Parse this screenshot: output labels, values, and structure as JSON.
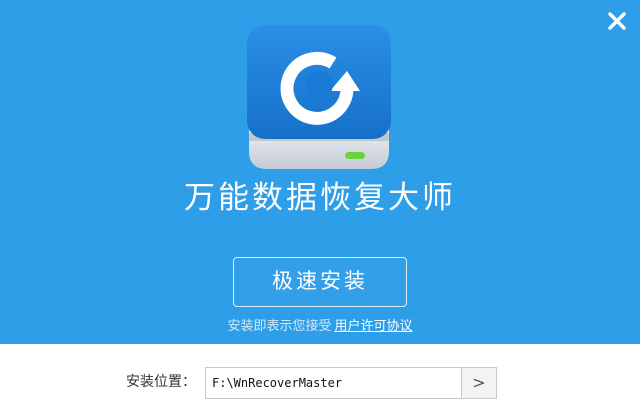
{
  "product": {
    "name": "万能数据恢复大师"
  },
  "actions": {
    "install_label": "极速安装",
    "agreement_text": "安装即表示您接受",
    "agreement_link": "用户许可协议"
  },
  "install_location": {
    "label": "安装位置：",
    "path_value": "F:\\WnRecoverMaster",
    "browse_label": ">"
  },
  "icons": {
    "close": "close-icon",
    "app": "app-logo-icon"
  },
  "colors": {
    "hero_background": "#2f9ee8",
    "footer_background": "#ffffff"
  }
}
